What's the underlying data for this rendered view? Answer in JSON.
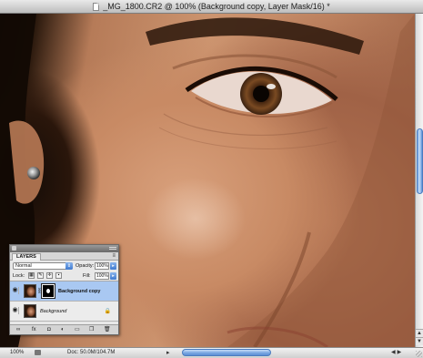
{
  "window": {
    "title": "_MG_1800.CR2 @ 100% (Background copy, Layer Mask/16) *"
  },
  "statusbar": {
    "zoom": "100%",
    "doc_size": "Doc: 50.0M/104.7M"
  },
  "layers_panel": {
    "tab_label": "LAYERS",
    "blend_mode": "Normal",
    "opacity_label": "Opacity:",
    "opacity_value": "100%",
    "lock_label": "Lock:",
    "fill_label": "Fill:",
    "fill_value": "100%",
    "layers": [
      {
        "name": "Background copy",
        "selected": true,
        "has_mask": true
      },
      {
        "name": "Background",
        "selected": false,
        "locked": true
      }
    ],
    "footer_buttons": [
      "link-icon",
      "fx-icon",
      "mask-icon",
      "adjustment-icon",
      "group-folder-icon",
      "new-layer-icon",
      "trash-icon"
    ]
  },
  "colors": {
    "selection_blue": "#a9c8f2",
    "scroll_thumb_blue": "#79a7e2"
  }
}
